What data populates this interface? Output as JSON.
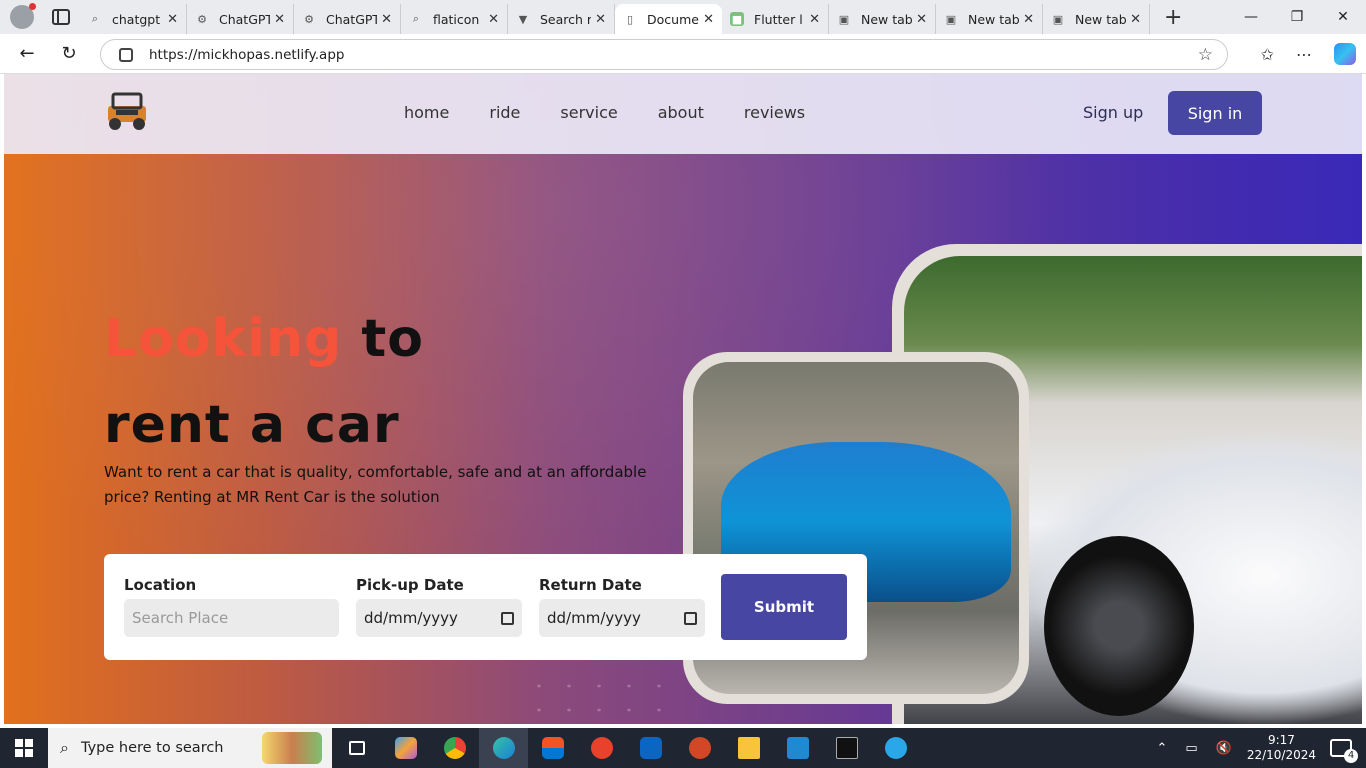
{
  "browser": {
    "tabs": [
      {
        "title": "chatgpt",
        "icon": "search-icon"
      },
      {
        "title": "ChatGPT",
        "icon": "chatgpt-icon"
      },
      {
        "title": "ChatGPT",
        "icon": "chatgpt-icon"
      },
      {
        "title": "flaticon",
        "icon": "search-icon"
      },
      {
        "title": "Search r",
        "icon": "vercel-icon"
      },
      {
        "title": "Docume",
        "icon": "document-icon",
        "active": true
      },
      {
        "title": "Flutter l",
        "icon": "flutter-icon"
      },
      {
        "title": "New tab",
        "icon": "newtab-icon"
      },
      {
        "title": "New tab",
        "icon": "newtab-icon"
      },
      {
        "title": "New tab",
        "icon": "newtab-icon"
      }
    ],
    "url": "https://mickhopas.netlify.app"
  },
  "site": {
    "nav": [
      "home",
      "ride",
      "service",
      "about",
      "reviews"
    ],
    "signup": "Sign up",
    "signin": "Sign in",
    "headline_highlight": "Looking",
    "headline_rest1": " to",
    "headline_line2": "rent a car",
    "description": "Want to rent a car that is quality, comfortable, safe and at an affordable price? Renting at MR Rent Car is the solution",
    "form": {
      "location_label": "Location",
      "location_placeholder": "Search Place",
      "pickup_label": "Pick-up Date",
      "pickup_value": "dd/mm/yyyy",
      "return_label": "Return Date",
      "return_value": "dd/mm/yyyy",
      "submit": "Submit"
    },
    "colors": {
      "accent": "#4747a3",
      "highlight": "#f5533a"
    }
  },
  "taskbar": {
    "search_placeholder": "Type here to search",
    "time": "9:17",
    "date": "22/10/2024",
    "notifications": "4"
  }
}
